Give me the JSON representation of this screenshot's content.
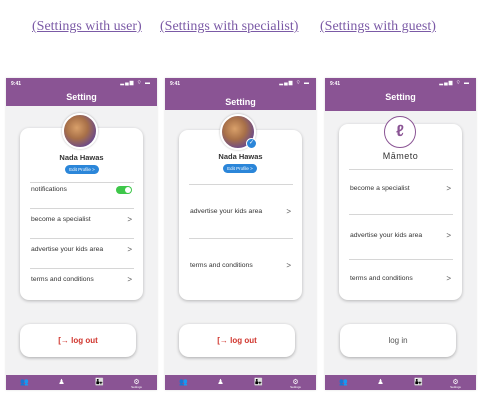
{
  "links": [
    "(Settings with user)",
    "(Settings with specialist)",
    "(Settings with guest)"
  ],
  "status": {
    "time": "9:41",
    "icons": "▂▄▆ ⌔ ▬"
  },
  "title": "Setting",
  "user": {
    "name": "Nada Hawas",
    "edit": "Edit Profile >",
    "rows": [
      {
        "label": "notifications",
        "toggle_on": true
      },
      {
        "label": "become a specialist",
        "arrow": ">"
      },
      {
        "label": "advertise your kids area",
        "arrow": ">"
      },
      {
        "label": "terms and conditions",
        "arrow": ">"
      }
    ],
    "logout": "[→ log out"
  },
  "specialist": {
    "name": "Nada Hawas",
    "edit": "Edit Profile >",
    "badge": "✓",
    "rows": [
      {
        "label": "advertise your kids area",
        "arrow": ">"
      },
      {
        "label": "terms and conditions",
        "arrow": ">"
      }
    ],
    "logout": "[→ log out"
  },
  "guest": {
    "brand": "Māmeto",
    "logo_letter": "ℓ",
    "rows": [
      {
        "label": "become a specialist",
        "arrow": ">"
      },
      {
        "label": "advertise your kids area",
        "arrow": ">"
      },
      {
        "label": "terms and conditions",
        "arrow": ">"
      }
    ],
    "login": "log in"
  },
  "tabs": [
    {
      "icon": "👥"
    },
    {
      "icon": "♟"
    },
    {
      "icon": "👨‍👧"
    },
    {
      "icon": "⚙",
      "label": "Settings"
    }
  ],
  "colors": {
    "brand_purple": "#8a5494",
    "link": "#7b5aa6",
    "logout_red": "#d0342c",
    "toggle_green": "#3ec74a",
    "edit_blue": "#2b86d9"
  }
}
